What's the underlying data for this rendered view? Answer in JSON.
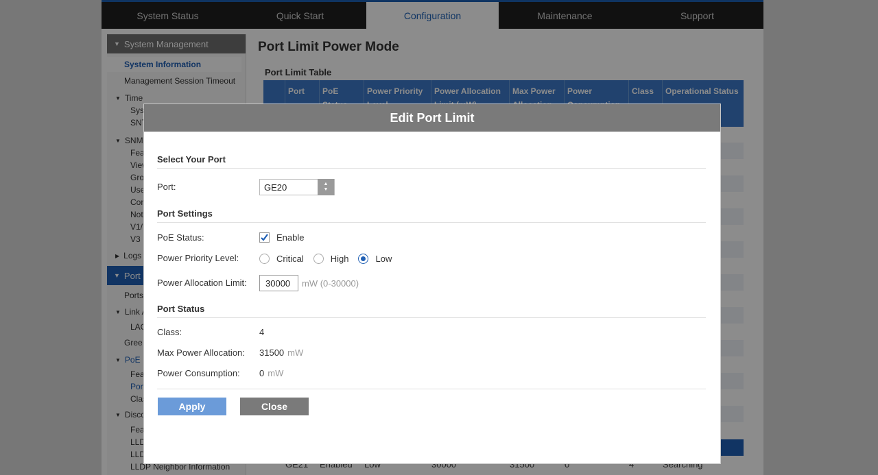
{
  "topnav": [
    "System Status",
    "Quick Start",
    "Configuration",
    "Maintenance",
    "Support"
  ],
  "sidebar": {
    "section_system": "System Management",
    "system_information": "System Information",
    "mgmt_session_timeout": "Management Session Timeout",
    "time": "Time",
    "time_children": [
      "Sys",
      "SNT"
    ],
    "snmp": "SNM",
    "snmp_children": [
      "Fea",
      "View",
      "Gro",
      "Use",
      "Com",
      "Noti",
      "V1/",
      "V3"
    ],
    "logs": "Logs",
    "section_port": "Port M",
    "ports": "Ports",
    "link_agg": "Link A",
    "lag": "LAG",
    "green": "Gree",
    "poe": "PoE",
    "poe_children": [
      "Fea",
      "Port",
      "Clas"
    ],
    "discovery": "Disco",
    "discovery_children": [
      "Fea",
      "LLD",
      "LLD",
      "LLDP Neighbor Information"
    ]
  },
  "main": {
    "title": "Port Limit Power Mode",
    "table_title": "Port Limit Table",
    "columns": [
      "Port",
      "PoE Status",
      "Power Priority Level",
      "Power Allocation Limit (mW)",
      "Max Power Allocation",
      "Power Consumption",
      "Class",
      "Operational Status"
    ],
    "last_row": [
      "GE21",
      "Enabled",
      "Low",
      "30000",
      "31500",
      "0",
      "4",
      "Searching"
    ]
  },
  "modal": {
    "title": "Edit Port Limit",
    "select_port_section": "Select Your Port",
    "port_label": "Port:",
    "port_value": "GE20",
    "port_settings_section": "Port Settings",
    "poe_status_label": "PoE Status:",
    "poe_enable_label": "Enable",
    "priority_label": "Power Priority Level:",
    "priority_options": [
      "Critical",
      "High",
      "Low"
    ],
    "priority_selected": "Low",
    "alloc_label": "Power Allocation Limit:",
    "alloc_value": "30000",
    "alloc_unit": "mW (0-30000)",
    "port_status_section": "Port Status",
    "class_label": "Class:",
    "class_value": "4",
    "max_alloc_label": "Max Power Allocation:",
    "max_alloc_value": "31500",
    "max_alloc_unit": "mW",
    "consumption_label": "Power Consumption:",
    "consumption_value": "0",
    "consumption_unit": "mW",
    "apply_label": "Apply",
    "close_label": "Close"
  },
  "colors": {
    "accent": "#1f5fb4",
    "apply_button": "#6b9bd9",
    "close_button": "#7a7a7a",
    "title_bar": "#7a7a7a"
  }
}
